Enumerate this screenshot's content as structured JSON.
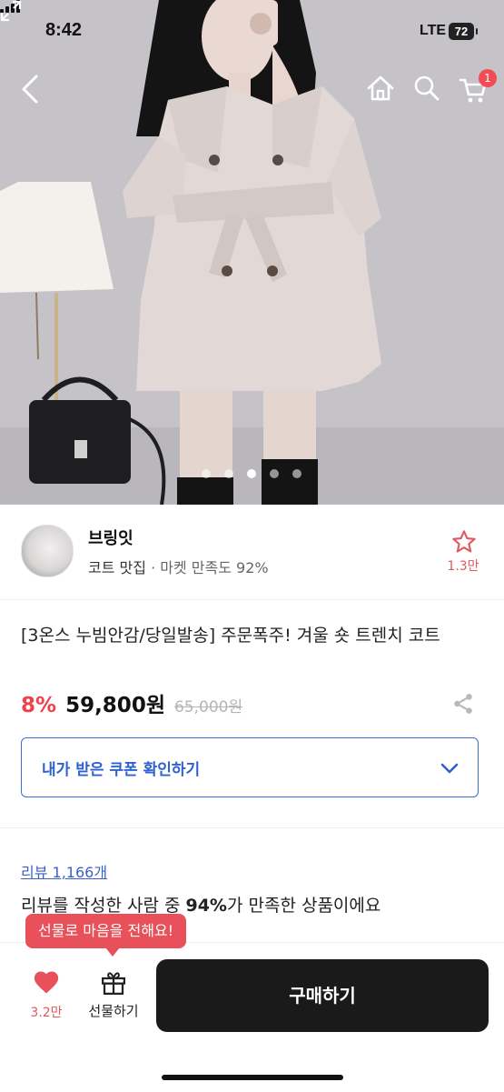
{
  "status_bar": {
    "time": "8:42",
    "network": "LTE",
    "battery": "72"
  },
  "top_nav": {
    "back_icon": "chevron-left-icon",
    "home_icon": "home-icon",
    "search_icon": "search-icon",
    "cart_icon": "cart-icon",
    "cart_badge": "1"
  },
  "gallery": {
    "total": 5,
    "active_index": 2,
    "expand_icon": "expand-icon"
  },
  "seller": {
    "name": "브링잇",
    "tag": "코트 맛집",
    "separator": "·",
    "satisfaction": "마켓 만족도 92%",
    "like_count": "1.3만",
    "like_icon": "star-icon"
  },
  "product": {
    "title": "[3온스 누빔안감/당일발송] 주문폭주! 겨울 숏 트렌치 코트",
    "discount": "8%",
    "price": "59,800원",
    "original_price": "65,000원",
    "share_icon": "share-icon"
  },
  "coupon": {
    "label": "내가 받은 쿠폰 확인하기",
    "icon": "chevron-down-icon"
  },
  "review": {
    "link": "리뷰 1,166개",
    "summary_prefix": "리뷰를 작성한 사람 중 ",
    "summary_highlight": "94%",
    "summary_suffix": "가 만족한 상품이에요"
  },
  "bottom_bar": {
    "tooltip": "선물로 마음을 전해요!",
    "heart_count": "3.2만",
    "gift_label": "선물하기",
    "buy_label": "구매하기"
  },
  "colors": {
    "accent_red": "#f0414a",
    "accent_blue": "#2f62cf",
    "buy_button": "#1a1a1a"
  }
}
